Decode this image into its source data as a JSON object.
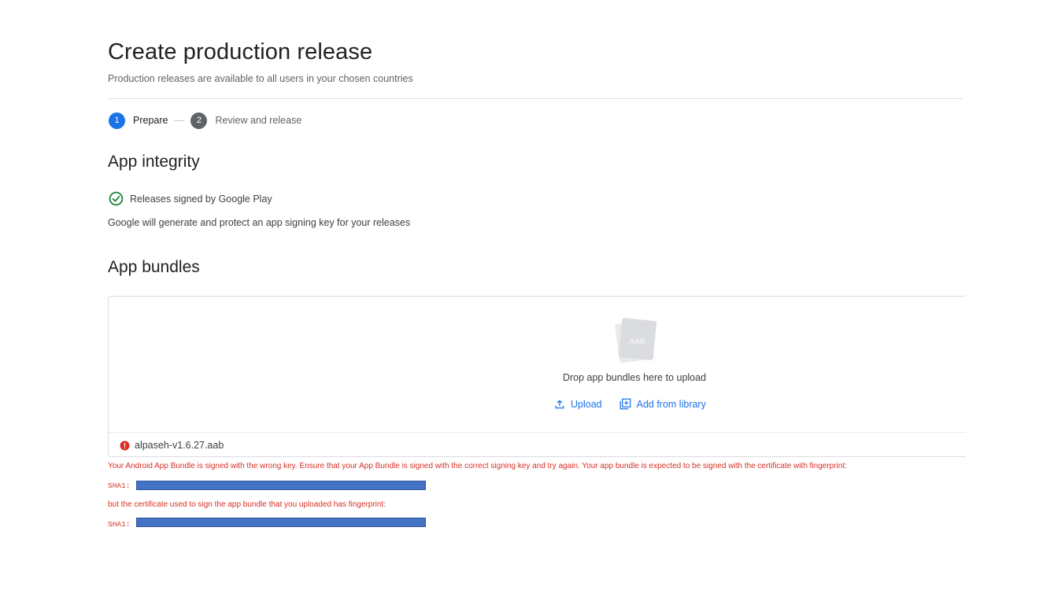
{
  "header": {
    "title": "Create production release",
    "subtitle": "Production releases are available to all users in your chosen countries"
  },
  "stepper": {
    "steps": [
      {
        "number": "1",
        "label": "Prepare",
        "state": "active"
      },
      {
        "number": "2",
        "label": "Review and release",
        "state": "inactive"
      }
    ]
  },
  "app_integrity": {
    "heading": "App integrity",
    "status_icon": "check-circle-icon",
    "status_text": "Releases signed by Google Play",
    "description": "Google will generate and protect an app signing key for your releases"
  },
  "app_bundles": {
    "heading": "App bundles",
    "drop_icon_label": ".AAB",
    "drop_text": "Drop app bundles here to upload",
    "upload_label": "Upload",
    "add_from_library_label": "Add from library",
    "file": {
      "name": "alpaseh-v1.6.27.aab",
      "status_icon": "error-icon"
    }
  },
  "error": {
    "message": "Your Android App Bundle is signed with the wrong key. Ensure that your App Bundle is signed with the correct signing key and try again. Your app bundle is expected to be signed with the certificate with fingerprint:",
    "expected_label": "SHA1:",
    "uploaded_message": "but the certificate used to sign the app bundle that you uploaded has fingerprint:",
    "uploaded_label": "SHA1:"
  },
  "colors": {
    "accent": "#1a73e8",
    "error": "#d93025",
    "success": "#188038",
    "redaction": "#4472c4"
  }
}
